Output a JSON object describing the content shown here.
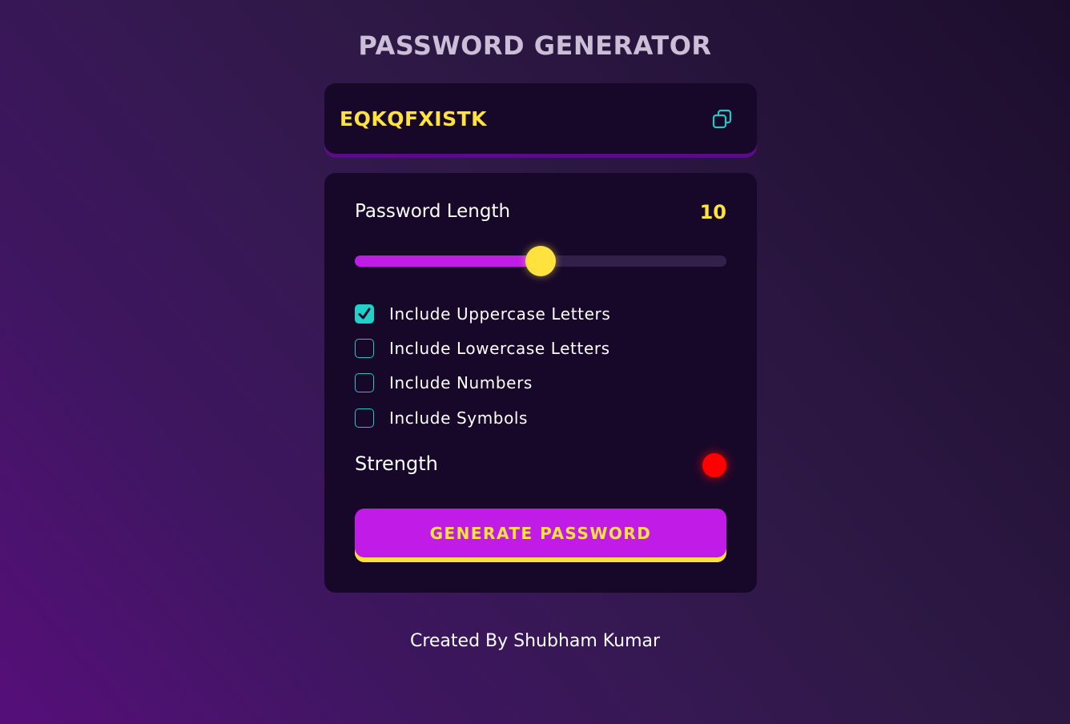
{
  "header": {
    "title": "PASSWORD GENERATOR"
  },
  "display": {
    "password": "EQKQFXISTK",
    "copy_icon": "copy-icon"
  },
  "length": {
    "label": "Password Length",
    "value": "10",
    "min": 0,
    "max": 20,
    "current": 10
  },
  "options": [
    {
      "label": "Include Uppercase Letters",
      "checked": true
    },
    {
      "label": "Include Lowercase Letters",
      "checked": false
    },
    {
      "label": "Include Numbers",
      "checked": false
    },
    {
      "label": "Include Symbols",
      "checked": false
    }
  ],
  "strength": {
    "label": "Strength",
    "color": "#ff0000"
  },
  "generate": {
    "label": "GENERATE PASSWORD"
  },
  "footer": {
    "text": "Created By Shubham Kumar"
  },
  "colors": {
    "accent": "#ffe23e",
    "primary": "#c11be8",
    "checkbox": "#1fd1c9",
    "panel": "#17082a"
  }
}
